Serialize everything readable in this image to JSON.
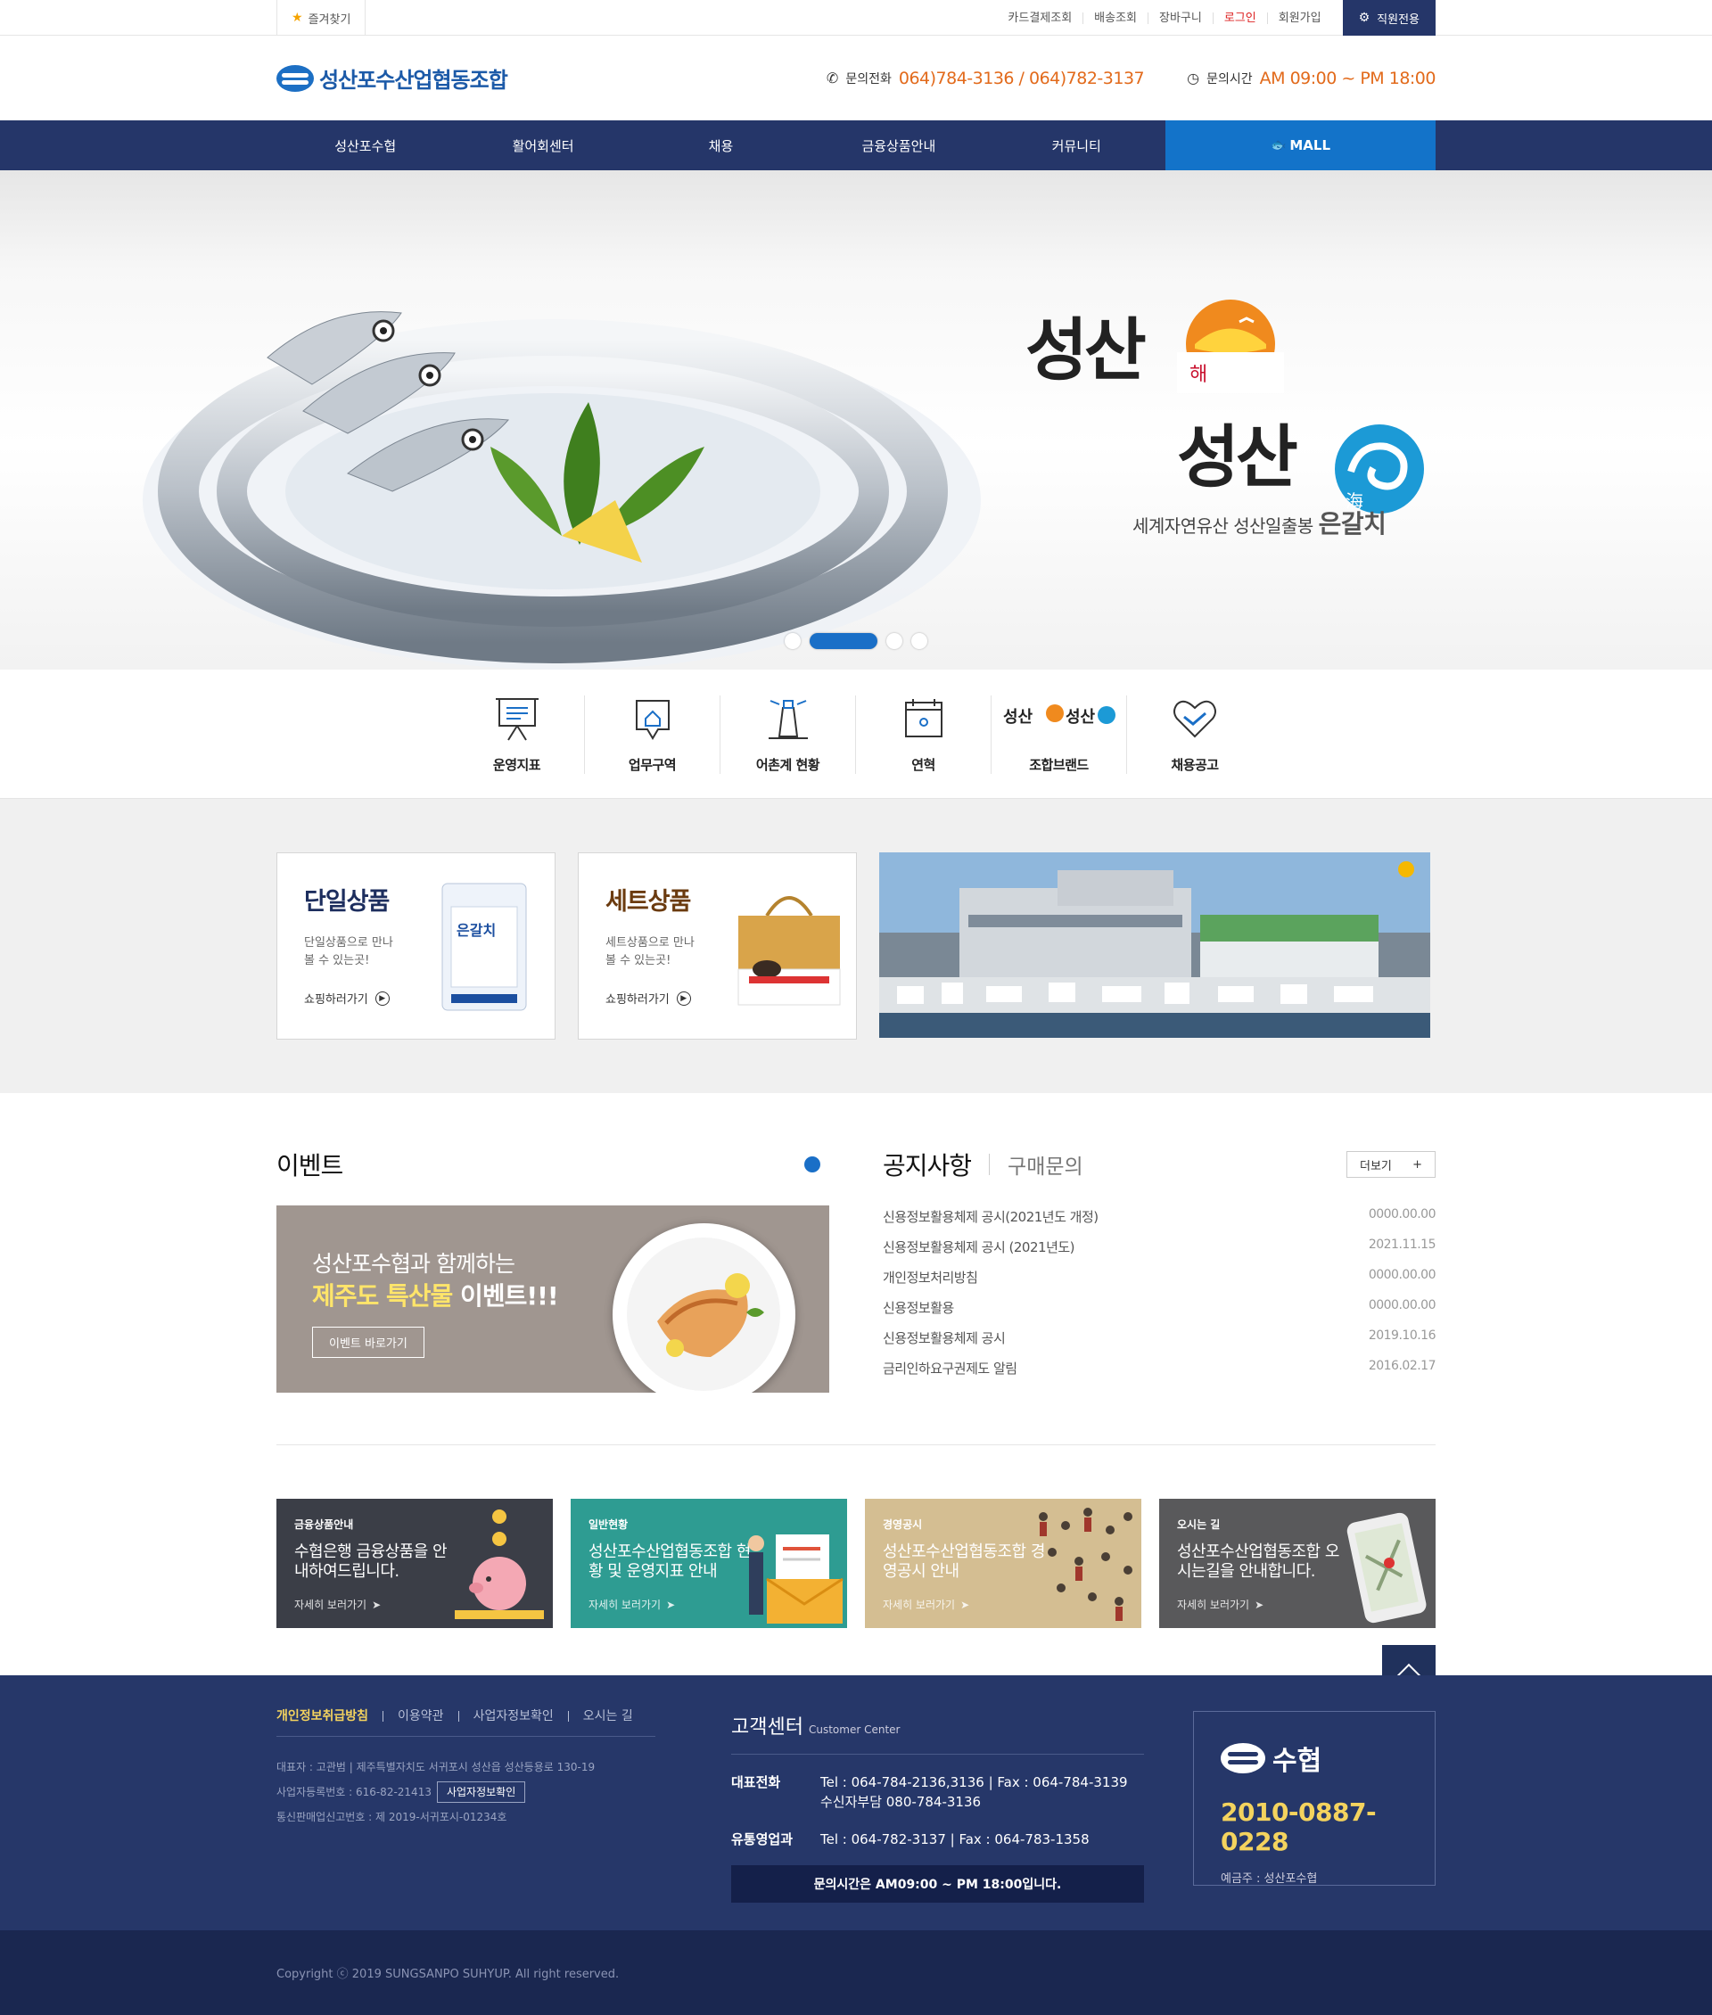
{
  "topbar": {
    "favorite": "즐겨찾기",
    "links": [
      "카드결제조회",
      "배송조회",
      "장바구니",
      "로그인",
      "회원가입"
    ],
    "staff": "직원전용"
  },
  "header": {
    "logo": "성산포수산업협동조합",
    "phone_label": "문의전화",
    "phone_value": "064)784-3136 / 064)782-3137",
    "hours_label": "문의시간",
    "hours_value": "AM 09:00 ~ PM 18:00"
  },
  "nav": {
    "items": [
      "성산포수협",
      "활어회센터",
      "채용",
      "금융상품안내",
      "커뮤니티"
    ],
    "mall": "MALL"
  },
  "hero": {
    "line1": "성산",
    "line1_small": "해",
    "line2": "성산",
    "line2_small": "海",
    "sub": "세계자연유산 성산일출봉",
    "sub_brand": "은갈치"
  },
  "quick": [
    "운영지표",
    "업무구역",
    "어촌계 현황",
    "연혁",
    "조합브랜드",
    "채용공고"
  ],
  "products": [
    {
      "title": "단일상품",
      "desc": "단일상품으로 만나볼 수 있는곳!",
      "link": "쇼핑하러가기",
      "pack_label": "은갈치"
    },
    {
      "title": "세트상품",
      "desc": "세트상품으로 만나볼 수 있는곳!",
      "link": "쇼핑하러가기"
    }
  ],
  "event": {
    "title": "이벤트",
    "line1": "성산포수협과 함께하는",
    "line2_hl": "제주도 특산물",
    "line2_rest": " 이벤트!!!",
    "button": "이벤트 바로가기"
  },
  "notice": {
    "tab1": "공지사항",
    "tab2": "구매문의",
    "more": "더보기",
    "items": [
      {
        "title": "신용정보활용체제 공시(2021년도 개정)",
        "date": "0000.00.00"
      },
      {
        "title": "신용정보활용체제 공시 (2021년도)",
        "date": "2021.11.15"
      },
      {
        "title": "개인정보처리방침",
        "date": "0000.00.00"
      },
      {
        "title": "신용정보활용",
        "date": "0000.00.00"
      },
      {
        "title": "신용정보활용체제 공시",
        "date": "2019.10.16"
      },
      {
        "title": "금리인하요구권제도 알림",
        "date": "2016.02.17"
      }
    ]
  },
  "cards": [
    {
      "tag": "금융상품안내",
      "title": "수협은행 금융상품을 안내하여드립니다.",
      "more": "자세히 보러가기"
    },
    {
      "tag": "일반현황",
      "title": "성산포수산업협동조합 현황 및 운영지표 안내",
      "more": "자세히 보러가기"
    },
    {
      "tag": "경영공시",
      "title": "성산포수산업협동조합 경영공시 안내",
      "more": "자세히 보러가기"
    },
    {
      "tag": "오시는 길",
      "title": "성산포수산업협동조합 오시는길을 안내합니다.",
      "more": "자세히 보러가기"
    }
  ],
  "footer": {
    "links": [
      "개인정보취급방침",
      "이용약관",
      "사업자정보확인",
      "오시는 길"
    ],
    "rep": "대표자 : 고관범  |  제주특별자치도 서귀포시 성산읍 성산등용로 130-19",
    "biz_no": "사업자등록번호 : 616-82-21413",
    "biz_btn": "사업자정보확인",
    "mail_order": "통신판매업신고번호 : 제 2019-서귀포시-01234호",
    "cc_title": "고객센터",
    "cc_sub": "Customer Center",
    "rows": [
      {
        "label": "대표전화",
        "line1": "Tel : 064-784-2136,3136  |  Fax : 064-784-3139",
        "line2": "수신자부담 080-784-3136"
      },
      {
        "label": "유통영업과",
        "line1": "Tel : 064-782-3137  |  Fax : 064-783-1358",
        "line2": ""
      }
    ],
    "hours": "문의시간은 AM09:00 ~ PM 18:00입니다.",
    "acct_brand": "수협",
    "acct_num": "2010-0887-0228",
    "acct_owner": "예금주 : 성산포수협",
    "copyright": "Copyright ⓒ 2019 SUNGSANPO SUHYUP. All right reserved."
  },
  "colors": {
    "navy": "#253669",
    "blue": "#1373c9",
    "orange": "#e26a1b",
    "yellow": "#f4d35e"
  }
}
